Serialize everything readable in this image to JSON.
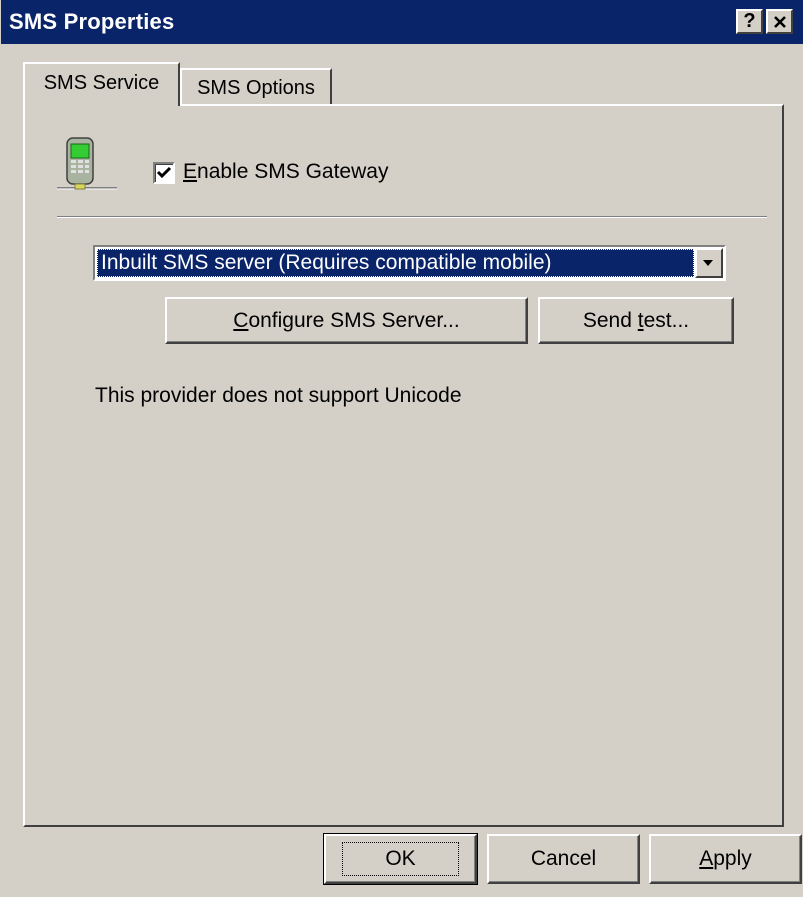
{
  "window": {
    "title": "SMS Properties",
    "help_button": "?",
    "close_button": "×"
  },
  "tabs": [
    {
      "label": "SMS Service",
      "active": true
    },
    {
      "label": "SMS Options",
      "active": false
    }
  ],
  "service": {
    "icon": "mobile-phone-icon",
    "enable_checkbox": {
      "label_prefix": "",
      "mnemonic": "E",
      "label_rest": "nable SMS Gateway",
      "checked": true
    },
    "provider_select": {
      "value": "Inbuilt SMS server (Requires compatible mobile)"
    },
    "configure_button": {
      "mnemonic": "C",
      "label_rest": "onfigure SMS Server..."
    },
    "send_test_button": {
      "label_prefix": "Send ",
      "mnemonic": "t",
      "label_rest": "est..."
    },
    "info_text": "This provider does not support Unicode"
  },
  "footer": {
    "ok_label": "OK",
    "cancel_label": "Cancel",
    "apply_mnemonic": "A",
    "apply_rest": "pply"
  },
  "colors": {
    "titlebar": "#0a246a",
    "face": "#d4d0c8",
    "selection": "#0a246a"
  }
}
